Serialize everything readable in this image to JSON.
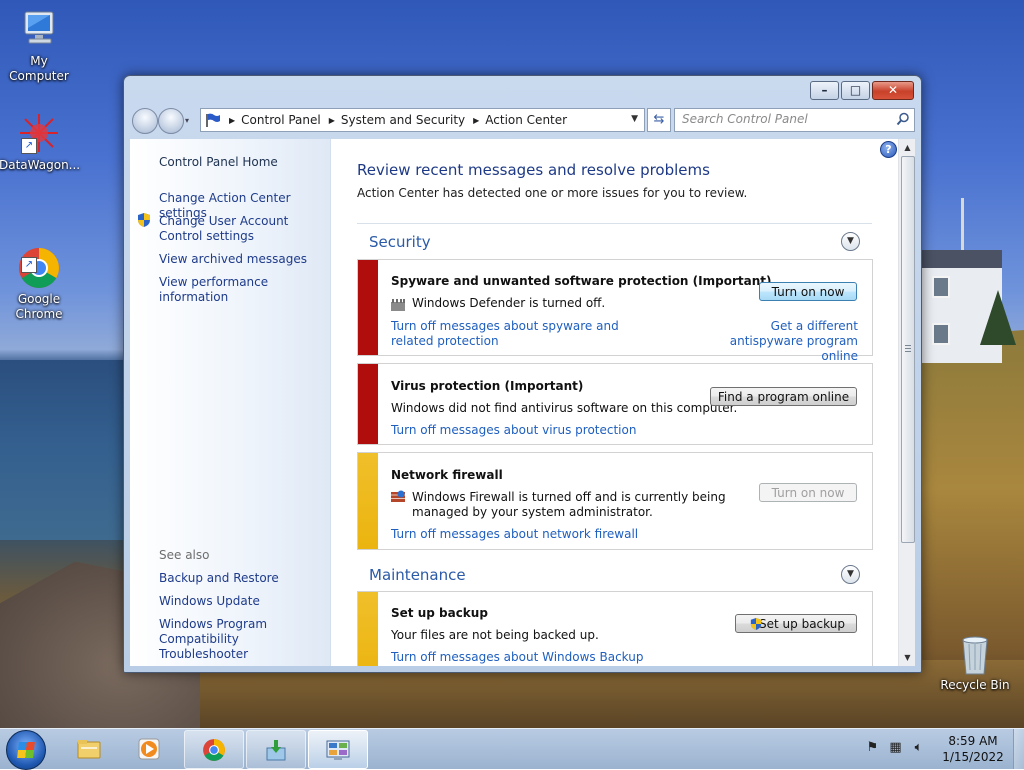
{
  "desktop": {
    "icons": [
      {
        "label": "My Computer"
      },
      {
        "label": "DataWagon..."
      },
      {
        "label": "Google\nChrome"
      },
      {
        "label": "Recycle Bin"
      }
    ]
  },
  "window": {
    "buttons": {
      "minimize": "–",
      "maximize": "□",
      "close": "✕"
    },
    "address": {
      "crumbs": [
        "Control Panel",
        "System and Security",
        "Action Center"
      ]
    },
    "search": {
      "placeholder": "Search Control Panel"
    },
    "left_pane": {
      "home": "Control Panel Home",
      "links": [
        "Change Action Center settings",
        "Change User Account Control settings",
        "View archived messages",
        "View performance information"
      ],
      "see_also_title": "See also",
      "see_also": [
        "Backup and Restore",
        "Windows Update",
        "Windows Program Compatibility Troubleshooter"
      ]
    },
    "content": {
      "help": "?",
      "title": "Review recent messages and resolve problems",
      "subtitle": "Action Center has detected one or more issues for you to review.",
      "sections": {
        "security": {
          "title": "Security",
          "items": [
            {
              "title": "Spyware and unwanted software protection  (Important)",
              "desc": "Windows Defender is turned off.",
              "link1": "Turn off messages about spyware and related protection",
              "link2": "Get a different antispyware program online",
              "button": "Turn on now",
              "color": "#b00d0d"
            },
            {
              "title": "Virus protection  (Important)",
              "desc": "Windows did not find antivirus software on this computer.",
              "link1": "Turn off messages about virus protection",
              "button": "Find a program online",
              "color": "#b00d0d"
            },
            {
              "title": "Network firewall",
              "desc": "Windows Firewall is turned off and is currently being managed by your system administrator.",
              "link1": "Turn off messages about network firewall",
              "button": "Turn on now",
              "color": "#ebb40f"
            }
          ]
        },
        "maintenance": {
          "title": "Maintenance",
          "items": [
            {
              "title": "Set up backup",
              "desc": "Your files are not being backed up.",
              "link1": "Turn off messages about Windows Backup",
              "button": "Set up backup",
              "color": "#ebb40f"
            }
          ]
        }
      }
    }
  },
  "taskbar": {
    "time": "8:59 AM",
    "date": "1/15/2022",
    "items": [
      "start",
      "explorer",
      "media-player",
      "chrome",
      "installer",
      "action-center"
    ]
  }
}
